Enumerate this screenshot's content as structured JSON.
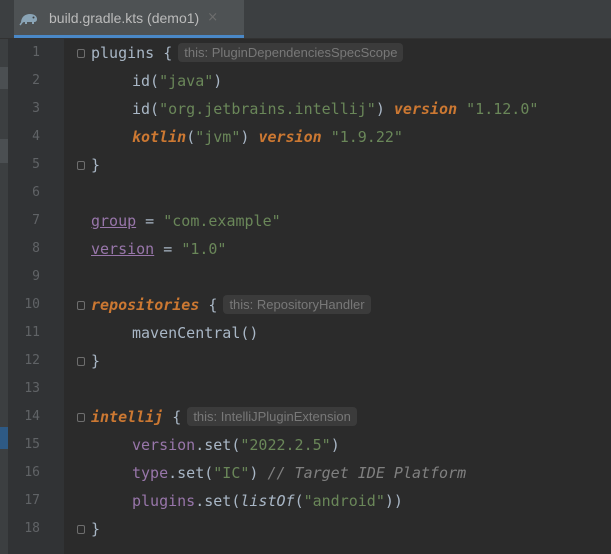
{
  "tab": {
    "title": "build.gradle.kts (demo1)",
    "close_glyph": "×",
    "icon": "gradle-elephant-icon"
  },
  "line_numbers": [
    "1",
    "2",
    "3",
    "4",
    "5",
    "6",
    "7",
    "8",
    "9",
    "10",
    "11",
    "12",
    "13",
    "14",
    "15",
    "16",
    "17",
    "18"
  ],
  "code": {
    "l1": {
      "kw": "plugins",
      "brace": " {",
      "hint": "this: PluginDependenciesSpecScope"
    },
    "l2": {
      "call": "id(",
      "str": "\"java\"",
      "close": ")"
    },
    "l3": {
      "call": "id(",
      "str": "\"org.jetbrains.intellij\"",
      "close": ") ",
      "kw": "version",
      "sp": " ",
      "str2": "\"1.12.0\""
    },
    "l4": {
      "fn": "kotlin",
      "open": "(",
      "str": "\"jvm\"",
      "close": ") ",
      "kw": "version",
      "sp": " ",
      "str2": "\"1.9.22\""
    },
    "l5": {
      "text": "}"
    },
    "l7": {
      "ref": "group",
      "op": " = ",
      "str": "\"com.example\""
    },
    "l8": {
      "ref": "version",
      "op": " = ",
      "str": "\"1.0\""
    },
    "l10": {
      "kw": "repositories",
      "brace": " {",
      "hint": "this: RepositoryHandler"
    },
    "l11": {
      "text": "mavenCentral()"
    },
    "l12": {
      "text": "}"
    },
    "l14": {
      "kw": "intellij",
      "brace": " {",
      "hint": "this: IntelliJPluginExtension"
    },
    "l15": {
      "ref": "version",
      "call": ".set(",
      "str": "\"2022.2.5\"",
      "close": ")"
    },
    "l16": {
      "ref": "type",
      "call": ".set(",
      "str": "\"IC\"",
      "close": ") ",
      "comment": "// Target IDE Platform"
    },
    "l17": {
      "ref": "plugins",
      "call": ".set(",
      "fn": "listOf",
      "open": "(",
      "str": "\"android\"",
      "close": "))"
    },
    "l18": {
      "text": "}"
    }
  },
  "colors": {
    "background": "#2b2b2b",
    "gutter": "#313335",
    "keyword": "#cc7832",
    "string": "#6a8759",
    "property": "#9876aa",
    "comment": "#808080",
    "text": "#a9b7c6"
  }
}
